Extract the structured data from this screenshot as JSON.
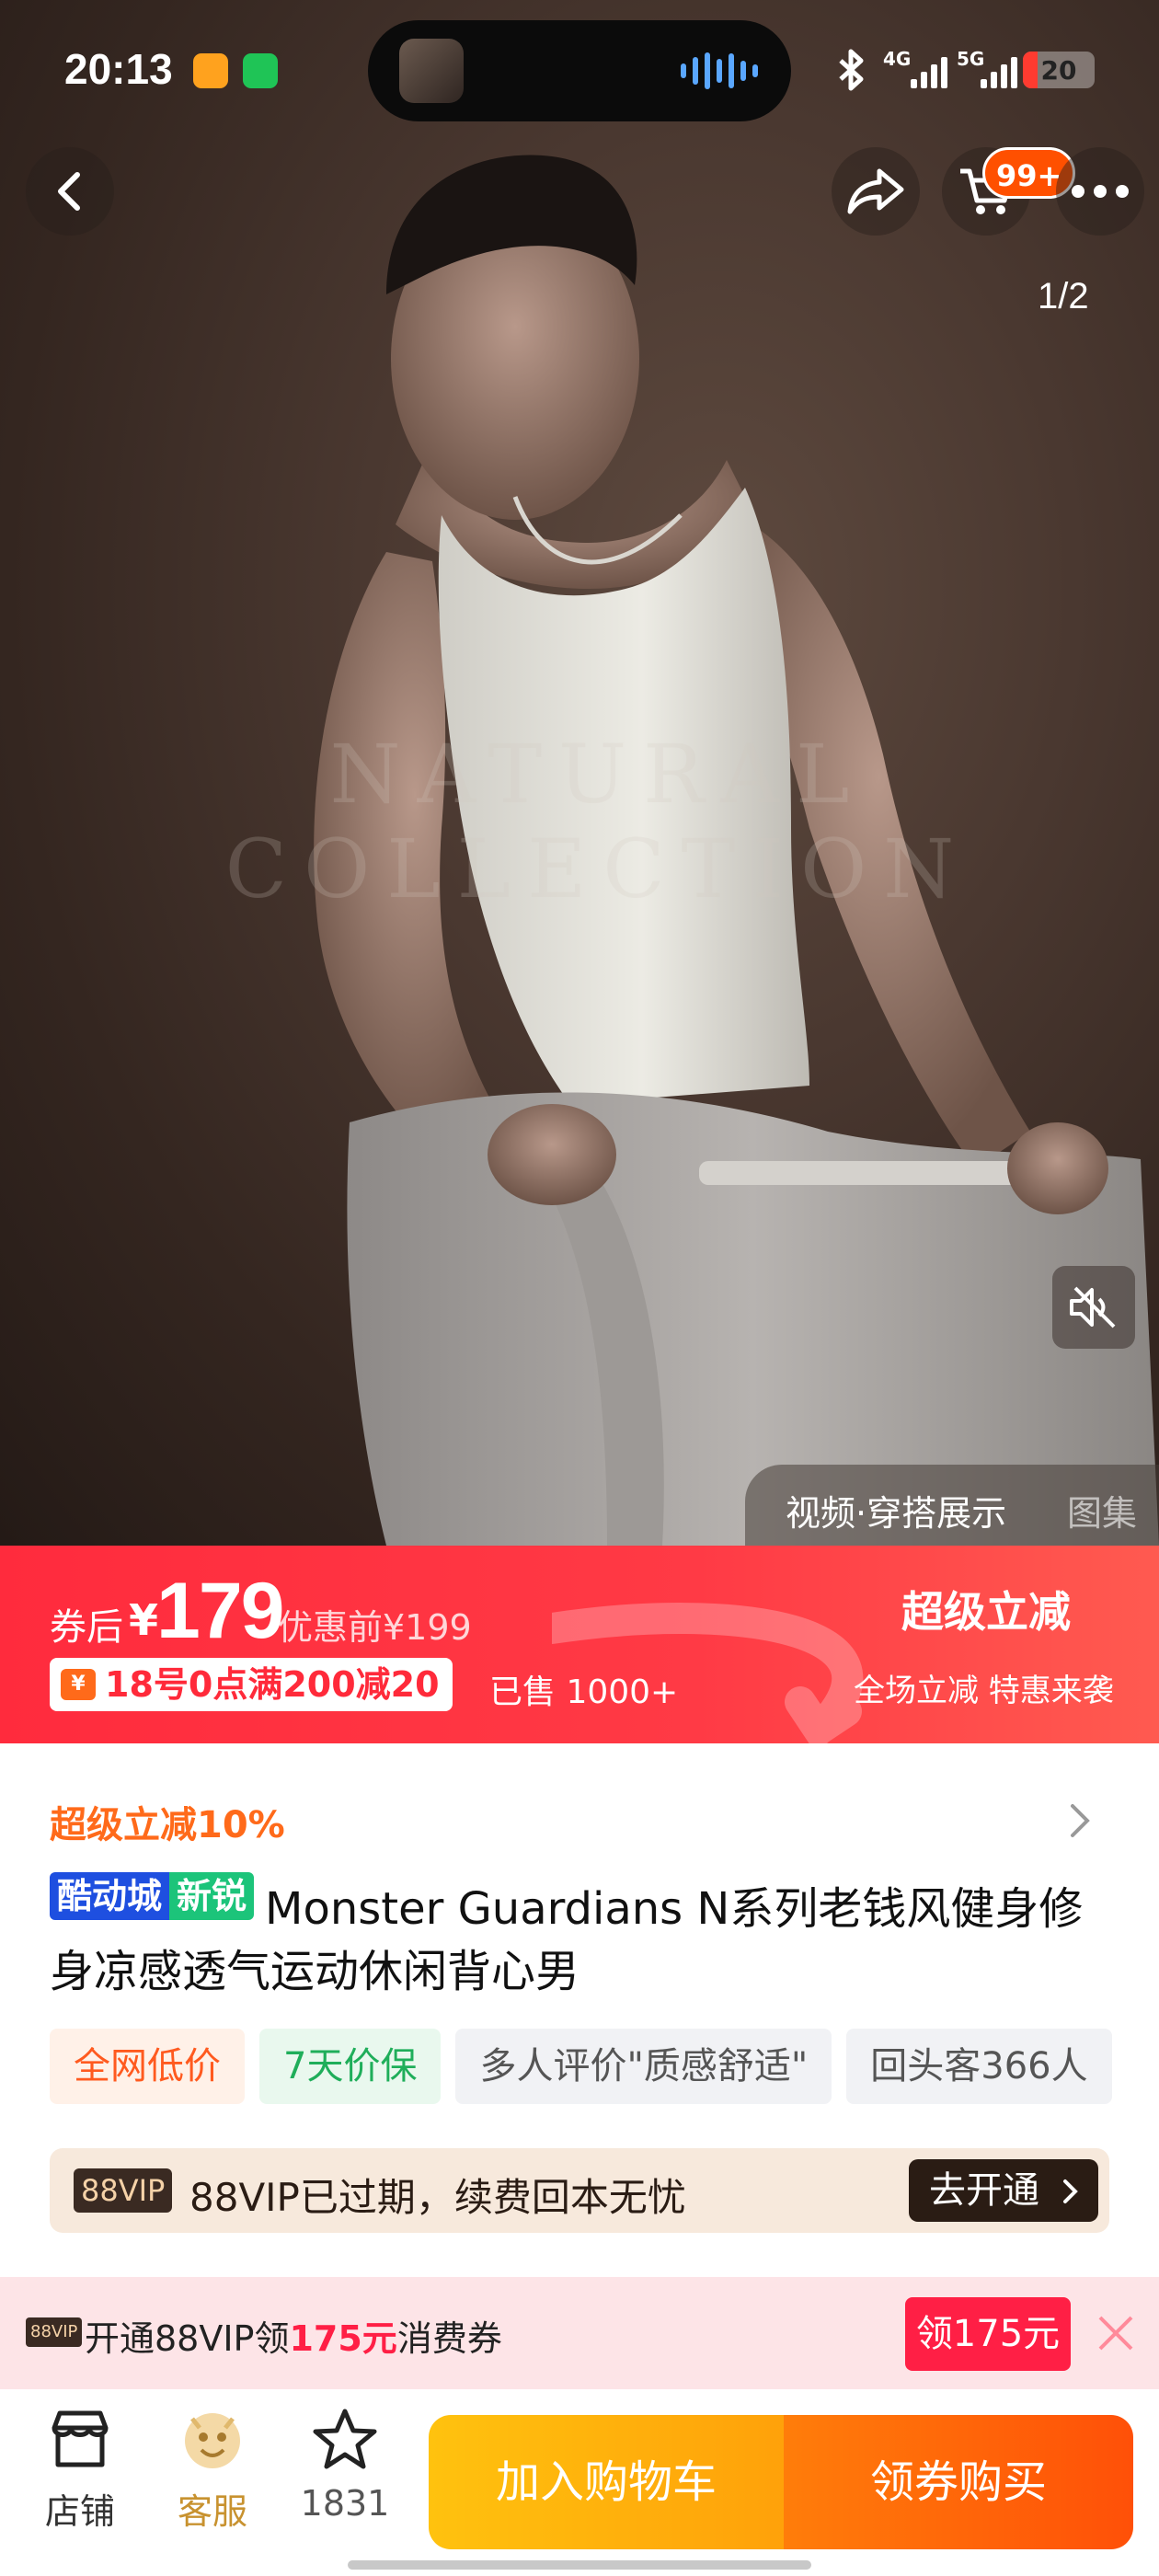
{
  "status_bar": {
    "time": "20:13",
    "net1": "4G",
    "net2": "5G",
    "battery": "20",
    "battery_level": 0.2
  },
  "nav": {
    "cart_badge": "99+",
    "pager": "1/2"
  },
  "hero": {
    "watermark": "NATURAL COLLECTION",
    "video_tab": "视频·穿搭展示",
    "gallery_tab": "图集"
  },
  "price": {
    "after_label": "券后",
    "currency": "¥",
    "value": "179",
    "original": "优惠前¥199",
    "coupon": "18号0点满200减20",
    "sold": "已售 1000+",
    "super_title": "超级立减",
    "super_sub": "全场立减 特惠来袭"
  },
  "product": {
    "discount_line": "超级立减10%",
    "brand_tag_1": "酷动城",
    "brand_tag_2": "新锐",
    "title": "Monster Guardians N系列老钱风健身修身凉感透气运动休闲背心男",
    "tags": [
      "全网低价",
      "7天价保",
      "多人评价\"质感舒适\"",
      "回头客366人"
    ]
  },
  "vip": {
    "logo": "88VIP",
    "text": "88VIP已过期，续费回本无忧",
    "button": "去开通"
  },
  "promo": {
    "logo": "88VIP",
    "text_pre": "开通88VIP领",
    "amount": "175元",
    "text_post": "消费券",
    "button": "领175元"
  },
  "bottom_bar": {
    "store": "店铺",
    "service": "客服",
    "favorites": "1831",
    "add_cart": "加入购物车",
    "buy": "领券购买"
  },
  "colors": {
    "accent_red": "#ff2b3d",
    "accent_orange": "#ff5000",
    "cart_yellow": "#ffc20e"
  }
}
